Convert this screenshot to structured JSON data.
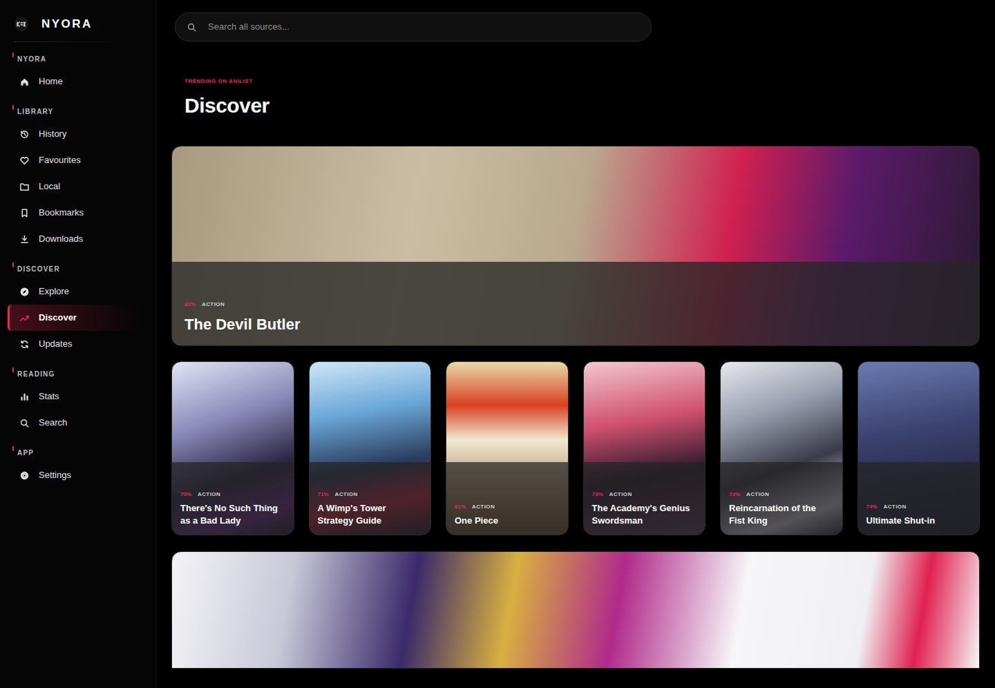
{
  "app": {
    "logo": "NYORA"
  },
  "search": {
    "placeholder": "Search all sources..."
  },
  "sidebar": {
    "sections": [
      {
        "label": "NYORA",
        "items": [
          {
            "label": "Home",
            "selected": false
          }
        ]
      },
      {
        "label": "LIBRARY",
        "items": [
          {
            "label": "History",
            "selected": false
          },
          {
            "label": "Favourites",
            "selected": false
          },
          {
            "label": "Local",
            "selected": false
          },
          {
            "label": "Bookmarks",
            "selected": false
          },
          {
            "label": "Downloads",
            "selected": false
          }
        ]
      },
      {
        "label": "DISCOVER",
        "items": [
          {
            "label": "Explore",
            "selected": false
          },
          {
            "label": "Discover",
            "selected": true
          },
          {
            "label": "Updates",
            "selected": false
          }
        ]
      },
      {
        "label": "READING",
        "items": [
          {
            "label": "Stats",
            "selected": false
          },
          {
            "label": "Search",
            "selected": false
          }
        ]
      },
      {
        "label": "APP",
        "items": [
          {
            "label": "Settings",
            "selected": false
          }
        ]
      }
    ]
  },
  "page": {
    "eyebrow": "TRENDING ON ANILIST",
    "title": "Discover"
  },
  "hero": {
    "score": "82%",
    "genre": "ACTION",
    "title": "The Devil Butler"
  },
  "cards": [
    {
      "score": "70%",
      "genre": "ACTION",
      "title": "There's No Such Thing as a Bad Lady"
    },
    {
      "score": "71%",
      "genre": "ACTION",
      "title": "A Wimp's Tower Strategy Guide"
    },
    {
      "score": "91%",
      "genre": "ACTION",
      "title": "One Piece"
    },
    {
      "score": "73%",
      "genre": "ACTION",
      "title": "The Academy's Genius Swordsman"
    },
    {
      "score": "73%",
      "genre": "ACTION",
      "title": "Reincarnation of the Fist King"
    },
    {
      "score": "74%",
      "genre": "ACTION",
      "title": "Ultimate Shut-in"
    }
  ]
}
